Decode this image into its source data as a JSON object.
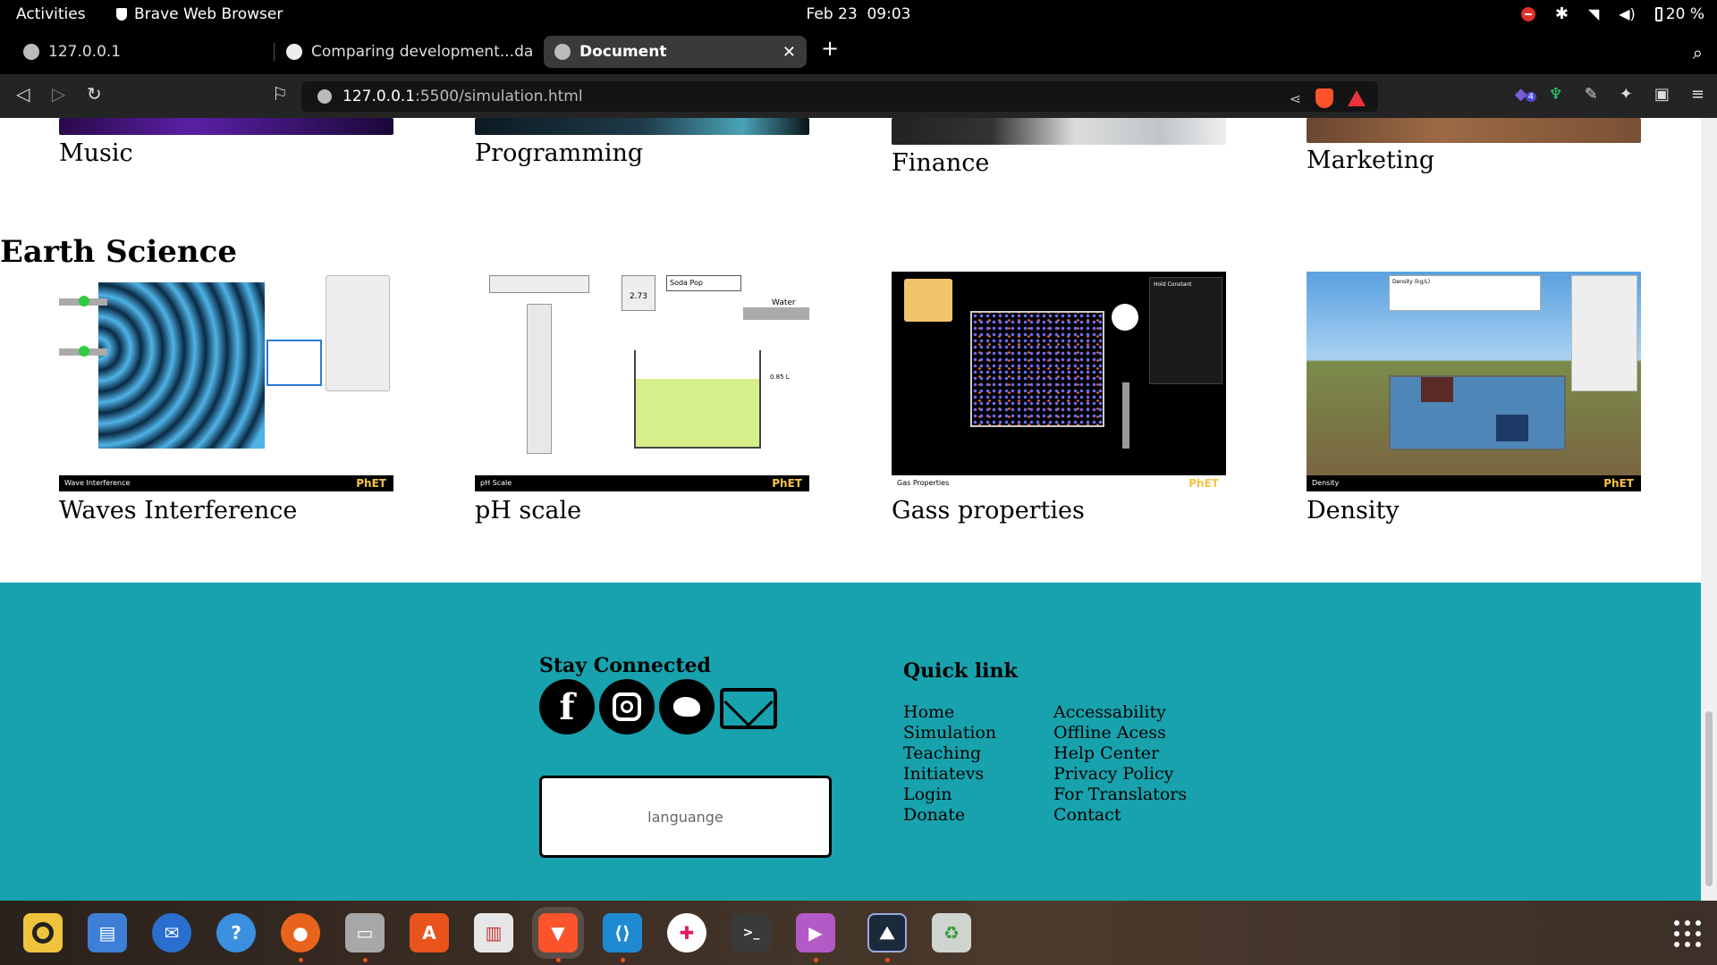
{
  "system_bar": {
    "activities": "Activities",
    "app_name": "Brave Web Browser",
    "date": "Feb 23",
    "time": "09:03",
    "battery": "20 %"
  },
  "tabs": [
    {
      "label": "127.0.0.1",
      "active": false
    },
    {
      "label": "Comparing development...da",
      "active": false
    },
    {
      "label": "Document",
      "active": true
    }
  ],
  "toolbar": {
    "url_host": "127.0.0.1",
    "url_rest": ":5500/simulation.html",
    "extension_badge": "4"
  },
  "top_cards": [
    {
      "label": "Music"
    },
    {
      "label": "Programming"
    },
    {
      "label": "Finance"
    },
    {
      "label": "Marketing"
    }
  ],
  "section": {
    "title": "Earth Science"
  },
  "sim_cards": [
    {
      "label": "Waves Interference",
      "bar_text": "Wave Interference"
    },
    {
      "label": "pH scale",
      "bar_text": "pH Scale"
    },
    {
      "label": "Gass properties",
      "bar_text": "Gas Properties"
    },
    {
      "label": "Density",
      "bar_text": "Density"
    }
  ],
  "sim_details": {
    "ph_value": "2.73",
    "ph_solution": "Soda Pop",
    "ph_water": "Water",
    "ph_volume": "0.85 L",
    "gas_hold": "Hold Constant",
    "density_title": "Density (kg/L)",
    "phet": "PhET"
  },
  "footer": {
    "stay_connected": "Stay Connected",
    "language_placeholder": "languange",
    "quick_link_title": "Quick link",
    "links_col1": [
      "Home",
      "Simulation",
      "Teaching",
      "Initiatevs",
      "Login",
      "Donate"
    ],
    "links_col2": [
      "Accessability",
      "Offline Acess",
      "Help Center",
      "Privacy Policy",
      "For Translators",
      "Contact"
    ]
  },
  "colors": {
    "footer_bg": "#17a2ad",
    "browser_chrome": "#242424"
  }
}
